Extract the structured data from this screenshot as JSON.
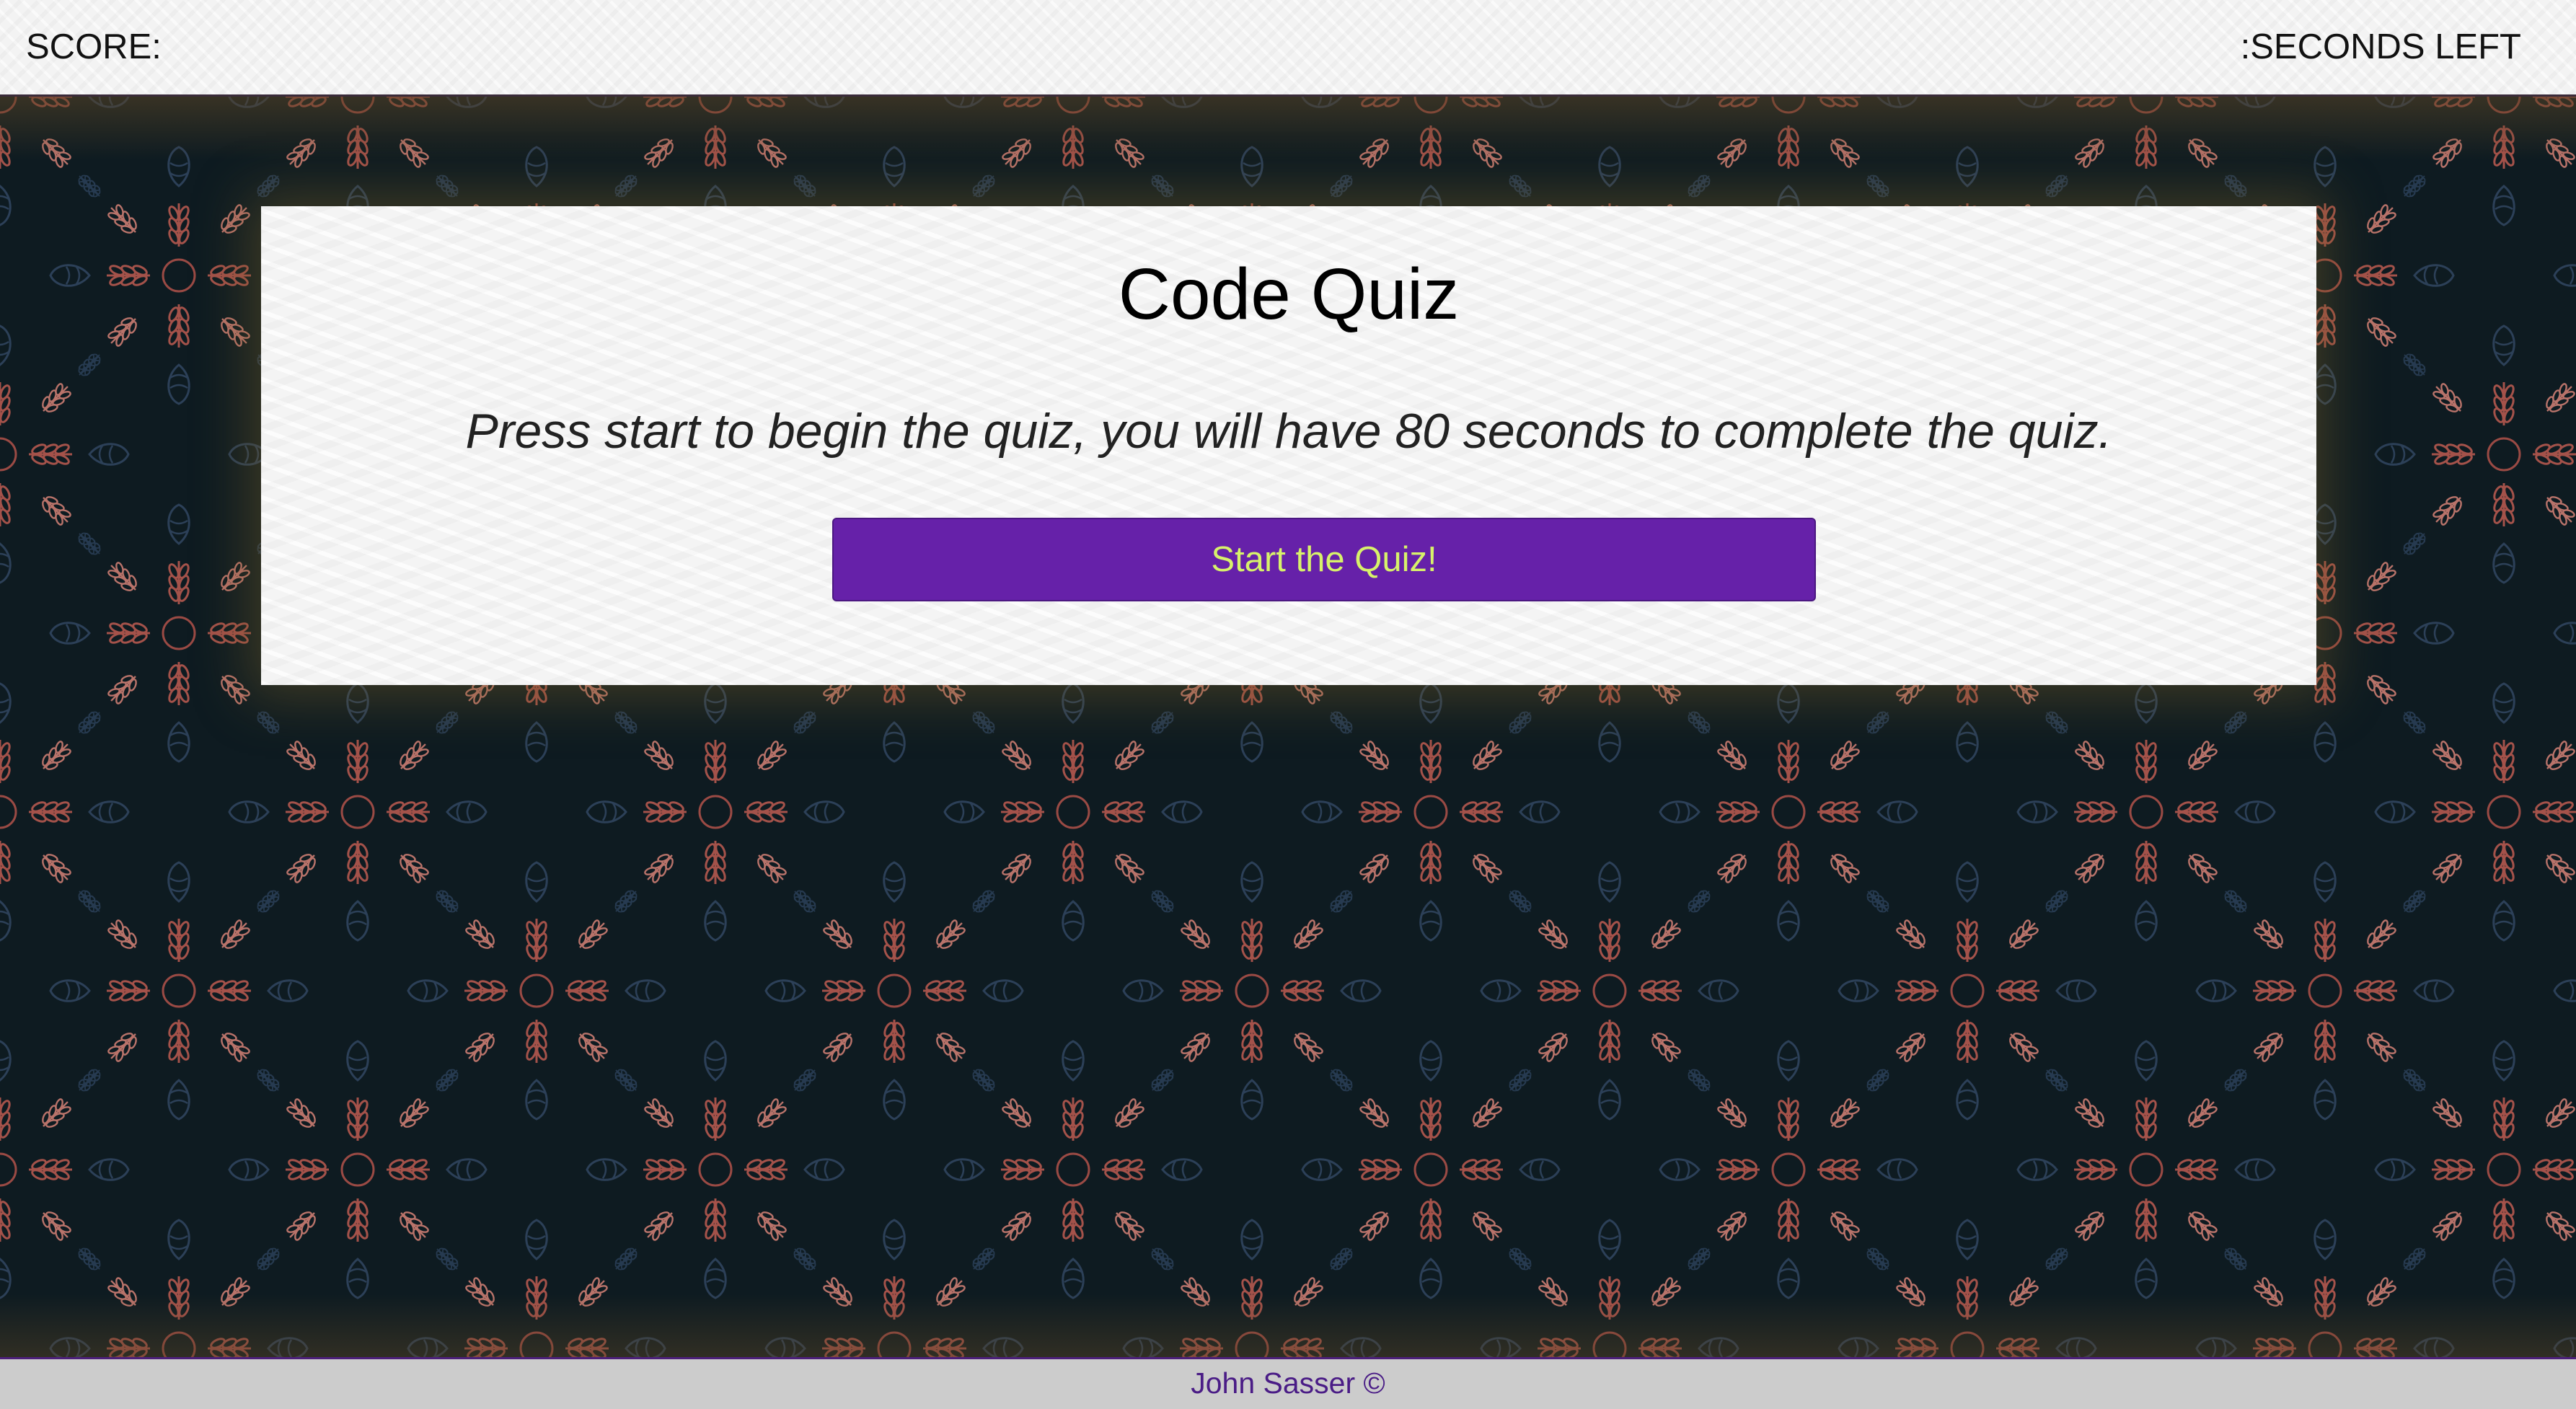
{
  "header": {
    "score_label": "SCORE:",
    "time_label": ":SECONDS LEFT"
  },
  "quiz": {
    "title": "Code Quiz",
    "instructions": "Press start to begin the quiz, you will have 80 seconds to complete the quiz.",
    "start_button_label": "Start the Quiz!"
  },
  "footer": {
    "text": "John Sasser ©"
  },
  "colors": {
    "button_bg": "#6621a9",
    "button_text": "#d7f26a",
    "footer_text": "#4a1c86",
    "background": "#0e1b21"
  }
}
